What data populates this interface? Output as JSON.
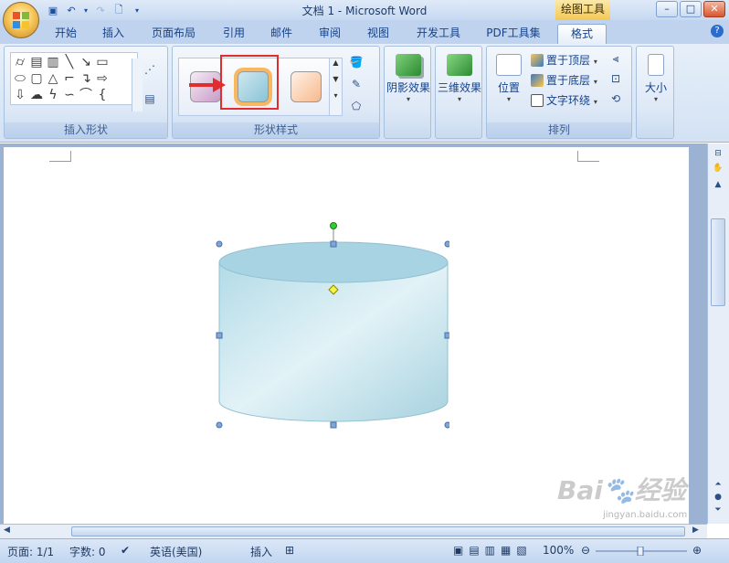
{
  "window": {
    "title": "文档 1 - Microsoft Word",
    "contextual_tab_group": "绘图工具"
  },
  "tabs": [
    "开始",
    "插入",
    "页面布局",
    "引用",
    "邮件",
    "审阅",
    "视图",
    "开发工具",
    "PDF工具集",
    "格式"
  ],
  "active_tab": "格式",
  "ribbon": {
    "insert_shapes_label": "插入形状",
    "shape_styles_label": "形状样式",
    "shadow_effects": "阴影效果",
    "threed_effects": "三维效果",
    "arrange_label": "排列",
    "position": "位置",
    "bring_to_front": "置于顶层",
    "send_to_back": "置于底层",
    "text_wrapping": "文字环绕",
    "size": "大小"
  },
  "shape_style_swatches": [
    {
      "name": "purple",
      "from": "#f6ecf6",
      "to": "#c79bc8"
    },
    {
      "name": "blue-orange",
      "from": "#cfe8f1",
      "to": "#89c3d6"
    },
    {
      "name": "orange",
      "from": "#fff1e6",
      "to": "#f8b98d"
    }
  ],
  "cylinder": {
    "fill_light": "#dff0f6",
    "fill_dark": "#9ccddd",
    "top": "#a8d3e2"
  },
  "status": {
    "page": "页面: 1/1",
    "words": "字数: 0",
    "language": "英语(美国)",
    "mode": "插入",
    "zoom": "100%"
  },
  "watermark": {
    "brand": "Bai",
    "brand2": "经验",
    "url": "jingyan.baidu.com"
  },
  "colors": {
    "accent_highlight": "#e02d2d",
    "ribbon_bg": "#d3e2f4"
  }
}
